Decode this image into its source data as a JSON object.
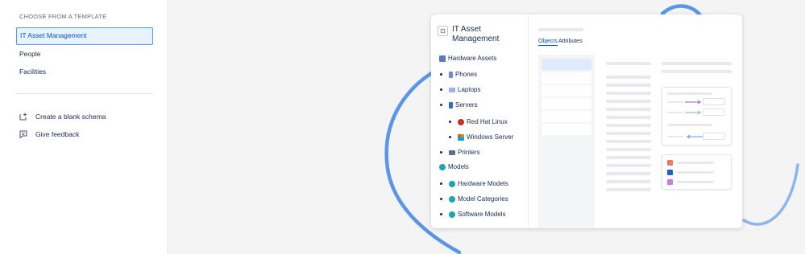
{
  "sidebar": {
    "section_title": "CHOOSE FROM A TEMPLATE",
    "templates": [
      {
        "label": "IT Asset Management",
        "selected": true
      },
      {
        "label": "People",
        "selected": false
      },
      {
        "label": "Facilities",
        "selected": false
      }
    ],
    "actions": [
      {
        "label": "Create a blank schema",
        "icon": "create-schema-icon"
      },
      {
        "label": "Give feedback",
        "icon": "feedback-icon"
      }
    ]
  },
  "preview": {
    "title": "IT Asset Management",
    "tabs": [
      {
        "label": "Objects",
        "active": true
      },
      {
        "label": "Attributes",
        "active": false
      }
    ],
    "tree": [
      {
        "label": "Hardware Assets",
        "icon": "hardware-assets-icon",
        "level": 0
      },
      {
        "label": "Phones",
        "icon": "phone-icon",
        "level": 1
      },
      {
        "label": "Laptops",
        "icon": "laptop-icon",
        "level": 1
      },
      {
        "label": "Servers",
        "icon": "server-icon",
        "level": 1
      },
      {
        "label": "Red Hat Linux",
        "icon": "red-hat-icon",
        "level": 2
      },
      {
        "label": "Windows Server",
        "icon": "windows-icon",
        "level": 2
      },
      {
        "label": "Printers",
        "icon": "printer-icon",
        "level": 1
      },
      {
        "label": "Models",
        "icon": "models-icon",
        "level": 0
      },
      {
        "label": "Hardware Models",
        "icon": "models-icon",
        "level": 1
      },
      {
        "label": "Model Categories",
        "icon": "models-icon",
        "level": 1
      },
      {
        "label": "Software Models",
        "icon": "models-icon",
        "level": 1
      }
    ]
  },
  "colors": {
    "accent": "#0052cc",
    "selected_border": "#4c9aff",
    "swoosh": "#5b95e8",
    "swatch_red": "#f87462",
    "swatch_blue": "#1d5fd1",
    "swatch_purple": "#c77be6",
    "teal": "#1aa4b8"
  }
}
